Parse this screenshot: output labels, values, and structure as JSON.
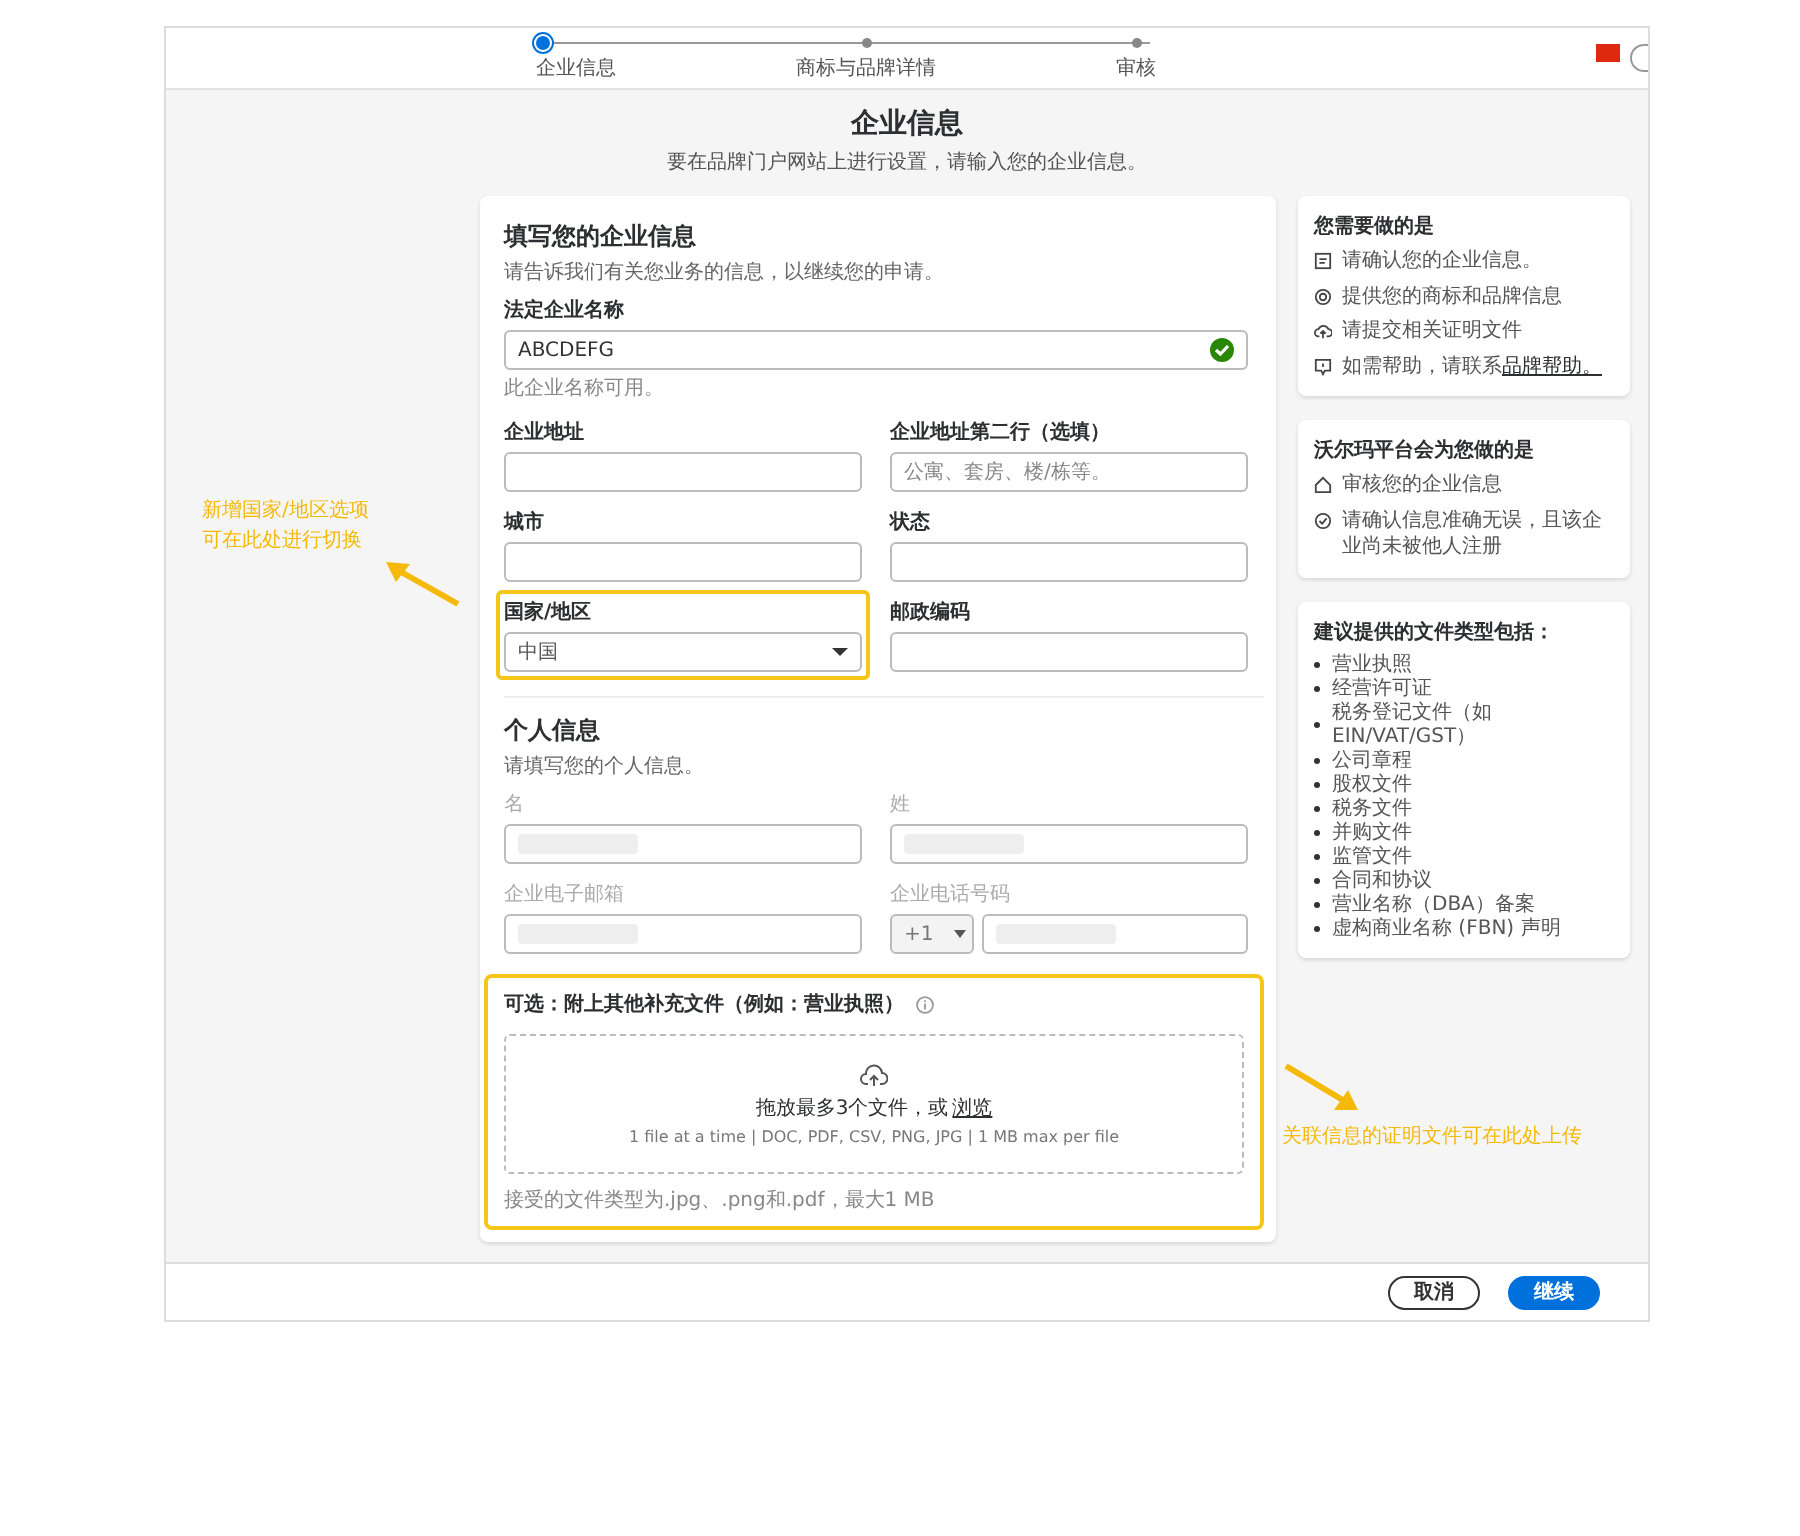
{
  "stepper": {
    "steps": [
      {
        "label": "企业信息",
        "selected": true
      },
      {
        "label": "商标与品牌详情",
        "selected": false
      },
      {
        "label": "审核",
        "selected": false
      }
    ]
  },
  "page": {
    "title": "企业信息",
    "subtitle": "要在品牌门户网站上进行设置，请输入您的企业信息。"
  },
  "business_form": {
    "heading": "填写您的企业信息",
    "description": "请告诉我们有关您业务的信息，以继续您的申请。",
    "rows": [
      [
        {
          "kind": "text",
          "label": "法定企业名称",
          "value": "ABCDEFG",
          "valid": true,
          "hint": "此企业名称可用。"
        }
      ],
      [
        {
          "kind": "text",
          "label": "企业地址"
        },
        {
          "kind": "text",
          "label": "企业地址第二行（选填）",
          "placeholder": "公寓、套房、楼/栋等。"
        }
      ],
      [
        {
          "kind": "text",
          "label": "城市"
        },
        {
          "kind": "text",
          "label": "状态"
        }
      ],
      [
        {
          "kind": "select",
          "label": "国家/地区",
          "value": "中国",
          "highlighted": true
        },
        {
          "kind": "text",
          "label": "邮政编码"
        }
      ]
    ]
  },
  "personal_form": {
    "heading": "个人信息",
    "description": "请填写您的个人信息。",
    "rows": [
      [
        {
          "kind": "redacted",
          "label": "名"
        },
        {
          "kind": "redacted",
          "label": "姓"
        }
      ],
      [
        {
          "kind": "redacted",
          "label": "企业电子邮箱"
        },
        {
          "kind": "phone",
          "label": "企业电话号码",
          "prefix": "+1"
        }
      ]
    ]
  },
  "upload": {
    "label": "可选：附上其他补充文件（例如：营业执照）",
    "highlighted": true,
    "prompt": "拖放最多3个文件，或",
    "browse_link": "浏览",
    "limits": "1 file at a time | DOC, PDF, CSV, PNG, JPG | 1 MB max per file",
    "note": "接受的文件类型为.jpg、.png和.pdf，最大1 MB"
  },
  "todo_card": {
    "title": "您需要做的是",
    "items": [
      {
        "kind": "document",
        "text": "请确认您的企业信息。"
      },
      {
        "kind": "badge",
        "text": "提供您的商标和品牌信息"
      },
      {
        "kind": "upload",
        "text": "请提交相关证明文件"
      },
      {
        "kind": "help",
        "text": "如需帮助，请联系",
        "link": "品牌帮助。"
      }
    ]
  },
  "platform_card": {
    "title": "沃尔玛平台会为您做的是",
    "items": [
      {
        "kind": "home",
        "text": "审核您的企业信息"
      },
      {
        "kind": "check",
        "text": "请确认信息准确无误，且该企业尚未被他人注册"
      }
    ]
  },
  "documents_card": {
    "title": "建议提供的文件类型包括：",
    "items": [
      "营业执照",
      "经营许可证",
      "税务登记文件（如 EIN/VAT/GST）",
      "公司章程",
      "股权文件",
      "税务文件",
      "并购文件",
      "监管文件",
      "合同和协议",
      "营业名称（DBA）备案",
      "虚构商业名称 (FBN) 声明"
    ]
  },
  "annotations": {
    "country": [
      "新增国家/地区选项",
      "可在此处进行切换"
    ],
    "upload": "关联信息的证明文件可在此处上传"
  },
  "footer": {
    "buttons": [
      {
        "kind": "secondary",
        "label": "取消"
      },
      {
        "kind": "primary",
        "label": "继续"
      }
    ]
  }
}
